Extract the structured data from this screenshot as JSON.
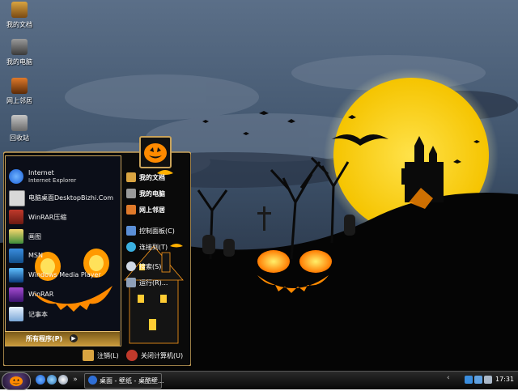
{
  "desktop": {
    "icons": [
      {
        "label": "我的文档",
        "icon": "my-documents-icon"
      },
      {
        "label": "我的电脑",
        "icon": "my-computer-icon"
      },
      {
        "label": "网上邻居",
        "icon": "network-places-icon"
      },
      {
        "label": "回收站",
        "icon": "recycle-bin-icon"
      }
    ]
  },
  "start_menu": {
    "pinned": [
      {
        "title": "Internet",
        "subtitle": "Internet Explorer",
        "icon": "internet-explorer-icon"
      },
      {
        "title": "电脑桌面DesktopBizhi.Com",
        "subtitle": "",
        "icon": "computer-desktop-icon"
      }
    ],
    "recent": [
      {
        "title": "WinRAR压缩",
        "icon": "winrar-icon"
      },
      {
        "title": "画图",
        "icon": "paint-icon"
      },
      {
        "title": "MSN",
        "icon": "msn-icon"
      },
      {
        "title": "Windows Media Player",
        "icon": "media-player-icon"
      },
      {
        "title": "WinRAR",
        "icon": "winrar-archive-icon"
      },
      {
        "title": "记事本",
        "icon": "notepad-icon"
      }
    ],
    "all_programs": "所有程序(P)",
    "places": [
      {
        "label": "我的文档",
        "icon": "my-documents-icon"
      },
      {
        "label": "我的电脑",
        "icon": "my-computer-icon"
      },
      {
        "label": "网上邻居",
        "icon": "network-places-icon"
      },
      {
        "label": "控制面板(C)",
        "icon": "control-panel-icon"
      },
      {
        "label": "连接到(T)",
        "icon": "connect-to-icon"
      },
      {
        "label": "搜索(S)",
        "icon": "search-icon"
      },
      {
        "label": "运行(R)...",
        "icon": "run-icon"
      }
    ],
    "logoff": "注销(L)",
    "shutdown": "关闭计算机(U)"
  },
  "taskbar": {
    "start_icon": "start-orb-icon",
    "task_button": "桌面 - 壁纸 - 桌酷壁...",
    "clock": "17:31"
  },
  "colors": {
    "moon": "#ffd21a",
    "pumpkin": "#ff8a00",
    "menu_border": "#c9a35a",
    "sky": "#3d5169"
  }
}
